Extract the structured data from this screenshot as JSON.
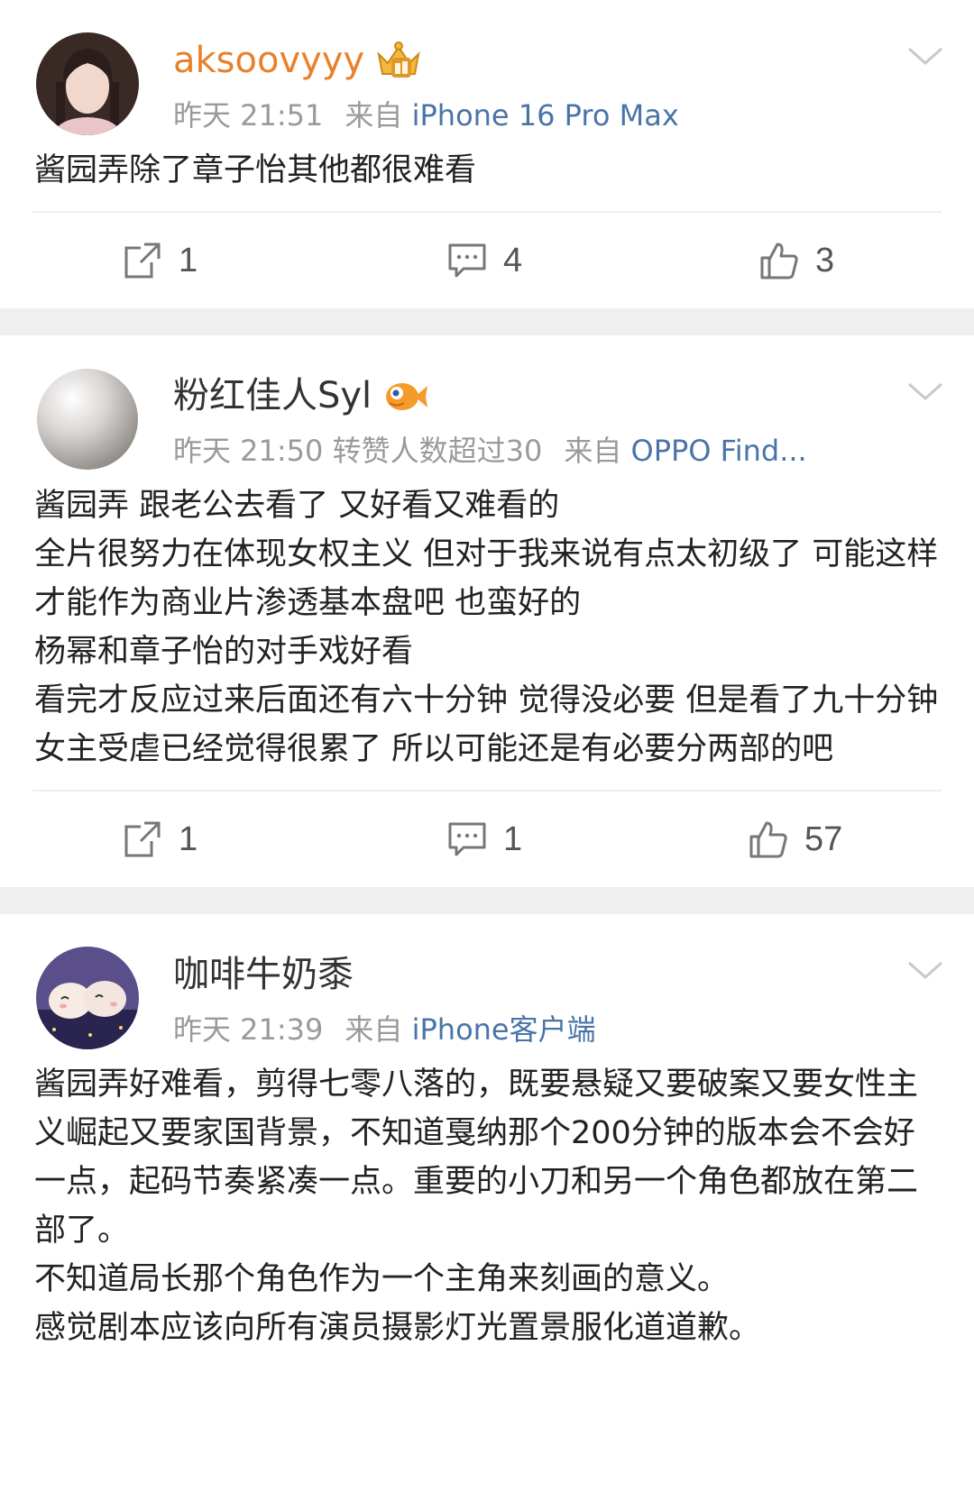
{
  "posts": [
    {
      "username": "aksoovyyy",
      "time": "昨天 21:51",
      "source_prefix": "来自",
      "source": "iPhone 16 Pro Max",
      "extra": "",
      "body": "酱园弄除了章子怡其他都很难看",
      "shares": "1",
      "comments": "4",
      "likes": "3"
    },
    {
      "username": "粉红佳人Syl",
      "time": "昨天 21:50",
      "extra": "转赞人数超过30",
      "source_prefix": "来自",
      "source": "OPPO Find...",
      "body": "酱园弄 跟老公去看了 又好看又难看的\n全片很努力在体现女权主义 但对于我来说有点太初级了 可能这样才能作为商业片渗透基本盘吧 也蛮好的\n杨幂和章子怡的对手戏好看\n看完才反应过来后面还有六十分钟 觉得没必要 但是看了九十分钟女主受虐已经觉得很累了 所以可能还是有必要分两部的吧",
      "shares": "1",
      "comments": "1",
      "likes": "57"
    },
    {
      "username": "咖啡牛奶黍",
      "time": "昨天 21:39",
      "source_prefix": "来自",
      "source": "iPhone客户端",
      "extra": "",
      "body": "酱园弄好难看，剪得七零八落的，既要悬疑又要破案又要女性主义崛起又要家国背景，不知道戛纳那个200分钟的版本会不会好一点，起码节奏紧凑一点。重要的小刀和另一个角色都放在第二部了。\n不知道局长那个角色作为一个主角来刻画的意义。\n感觉剧本应该向所有演员摄影灯光置景服化道道歉。"
    }
  ],
  "icons": {
    "share": "share-icon",
    "comment": "comment-icon",
    "like": "thumbs-up-icon",
    "more": "chevron-down-icon",
    "vip_badge": "crown-badge-icon",
    "fan_badge": "fish-badge-icon"
  },
  "colors": {
    "vip_name": "#e8812b",
    "source_link": "#4a74a8",
    "meta": "#9a9a9a",
    "separator": "#efefef"
  }
}
